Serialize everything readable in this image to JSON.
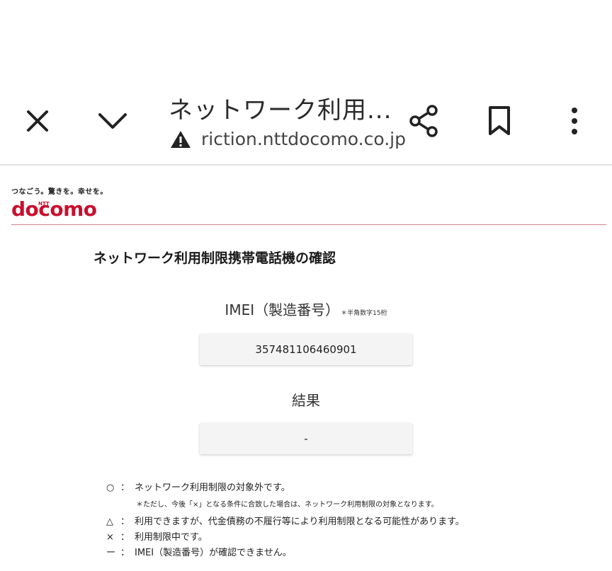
{
  "browser": {
    "page_title": "ネットワーク利用...",
    "url": "riction.nttdocomo.co.jp",
    "icons": [
      "close-icon",
      "chevron-down-icon",
      "warning-icon",
      "share-icon",
      "bookmark-icon",
      "more-vert-icon"
    ]
  },
  "header": {
    "tagline": "つなごう。驚きを。幸せを。",
    "logo_small": "NTT",
    "logo_text": "docomo",
    "brand_color": "#c8102e"
  },
  "main": {
    "title": "ネットワーク利用制限携帯電話機の確認",
    "imei_label": "IMEI（製造番号）",
    "imei_note": "＊半角数字15桁",
    "imei_value": "357481106460901",
    "result_label": "結果",
    "result_value": "-"
  },
  "legend": [
    {
      "symbol": "○",
      "text": "ネットワーク利用制限の対象外です。"
    },
    {
      "note": "＊ただし、今後「×」となる条件に合致した場合は、ネットワーク利用制限の対象となります。"
    },
    {
      "symbol": "△",
      "text": "利用できますが、代金債務の不履行等により利用制限となる可能性があります。"
    },
    {
      "symbol": "×",
      "text": "利用制限中です。"
    },
    {
      "symbol": "ー",
      "text": "IMEI（製造番号）が確認できません。"
    }
  ]
}
